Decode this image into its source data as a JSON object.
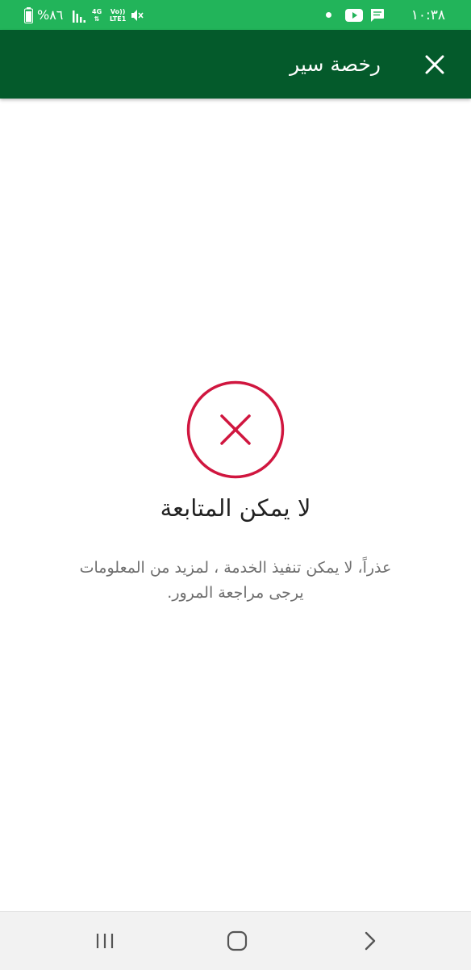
{
  "status_bar": {
    "time": "١٠:٣٨",
    "battery_percent": "%٨٦",
    "network_4g": "4G",
    "network_volte_top": "Vo))",
    "network_volte_bottom": "LTE1",
    "icons": [
      "battery-icon",
      "signal-icon",
      "mute-icon",
      "notification-dot-icon",
      "youtube-icon",
      "message-icon"
    ]
  },
  "app_bar": {
    "title": "رخصة سير",
    "close_icon": "close-icon"
  },
  "error": {
    "icon": "error-x-circle-icon",
    "icon_color": "#d0163f",
    "title": "لا يمكن المتابعة",
    "message_line1": "عذراً، لا يمكن تنفيذ الخدمة ، لمزيد من المعلومات",
    "message_line2": "يرجى مراجعة المرور."
  },
  "nav_bar": {
    "buttons": [
      "recents-icon",
      "home-icon",
      "back-icon"
    ]
  },
  "colors": {
    "status_bar": "#22b45a",
    "app_bar": "#045a2b",
    "accent_error": "#d0163f",
    "nav_bar": "#f2f2f2"
  }
}
